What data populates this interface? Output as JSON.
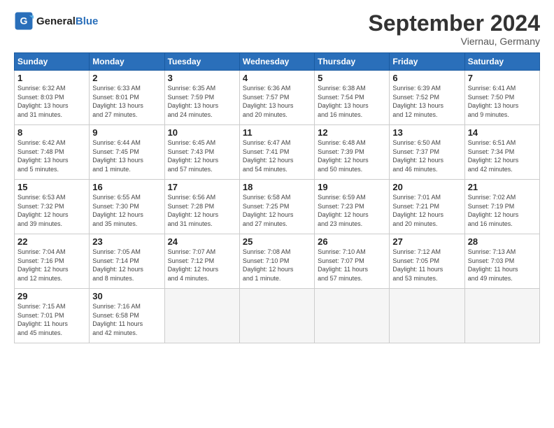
{
  "header": {
    "logo_general": "General",
    "logo_blue": "Blue",
    "month_title": "September 2024",
    "subtitle": "Viernau, Germany"
  },
  "weekdays": [
    "Sunday",
    "Monday",
    "Tuesday",
    "Wednesday",
    "Thursday",
    "Friday",
    "Saturday"
  ],
  "weeks": [
    [
      {
        "day": "1",
        "info": "Sunrise: 6:32 AM\nSunset: 8:03 PM\nDaylight: 13 hours\nand 31 minutes."
      },
      {
        "day": "2",
        "info": "Sunrise: 6:33 AM\nSunset: 8:01 PM\nDaylight: 13 hours\nand 27 minutes."
      },
      {
        "day": "3",
        "info": "Sunrise: 6:35 AM\nSunset: 7:59 PM\nDaylight: 13 hours\nand 24 minutes."
      },
      {
        "day": "4",
        "info": "Sunrise: 6:36 AM\nSunset: 7:57 PM\nDaylight: 13 hours\nand 20 minutes."
      },
      {
        "day": "5",
        "info": "Sunrise: 6:38 AM\nSunset: 7:54 PM\nDaylight: 13 hours\nand 16 minutes."
      },
      {
        "day": "6",
        "info": "Sunrise: 6:39 AM\nSunset: 7:52 PM\nDaylight: 13 hours\nand 12 minutes."
      },
      {
        "day": "7",
        "info": "Sunrise: 6:41 AM\nSunset: 7:50 PM\nDaylight: 13 hours\nand 9 minutes."
      }
    ],
    [
      {
        "day": "8",
        "info": "Sunrise: 6:42 AM\nSunset: 7:48 PM\nDaylight: 13 hours\nand 5 minutes."
      },
      {
        "day": "9",
        "info": "Sunrise: 6:44 AM\nSunset: 7:45 PM\nDaylight: 13 hours\nand 1 minute."
      },
      {
        "day": "10",
        "info": "Sunrise: 6:45 AM\nSunset: 7:43 PM\nDaylight: 12 hours\nand 57 minutes."
      },
      {
        "day": "11",
        "info": "Sunrise: 6:47 AM\nSunset: 7:41 PM\nDaylight: 12 hours\nand 54 minutes."
      },
      {
        "day": "12",
        "info": "Sunrise: 6:48 AM\nSunset: 7:39 PM\nDaylight: 12 hours\nand 50 minutes."
      },
      {
        "day": "13",
        "info": "Sunrise: 6:50 AM\nSunset: 7:37 PM\nDaylight: 12 hours\nand 46 minutes."
      },
      {
        "day": "14",
        "info": "Sunrise: 6:51 AM\nSunset: 7:34 PM\nDaylight: 12 hours\nand 42 minutes."
      }
    ],
    [
      {
        "day": "15",
        "info": "Sunrise: 6:53 AM\nSunset: 7:32 PM\nDaylight: 12 hours\nand 39 minutes."
      },
      {
        "day": "16",
        "info": "Sunrise: 6:55 AM\nSunset: 7:30 PM\nDaylight: 12 hours\nand 35 minutes."
      },
      {
        "day": "17",
        "info": "Sunrise: 6:56 AM\nSunset: 7:28 PM\nDaylight: 12 hours\nand 31 minutes."
      },
      {
        "day": "18",
        "info": "Sunrise: 6:58 AM\nSunset: 7:25 PM\nDaylight: 12 hours\nand 27 minutes."
      },
      {
        "day": "19",
        "info": "Sunrise: 6:59 AM\nSunset: 7:23 PM\nDaylight: 12 hours\nand 23 minutes."
      },
      {
        "day": "20",
        "info": "Sunrise: 7:01 AM\nSunset: 7:21 PM\nDaylight: 12 hours\nand 20 minutes."
      },
      {
        "day": "21",
        "info": "Sunrise: 7:02 AM\nSunset: 7:19 PM\nDaylight: 12 hours\nand 16 minutes."
      }
    ],
    [
      {
        "day": "22",
        "info": "Sunrise: 7:04 AM\nSunset: 7:16 PM\nDaylight: 12 hours\nand 12 minutes."
      },
      {
        "day": "23",
        "info": "Sunrise: 7:05 AM\nSunset: 7:14 PM\nDaylight: 12 hours\nand 8 minutes."
      },
      {
        "day": "24",
        "info": "Sunrise: 7:07 AM\nSunset: 7:12 PM\nDaylight: 12 hours\nand 4 minutes."
      },
      {
        "day": "25",
        "info": "Sunrise: 7:08 AM\nSunset: 7:10 PM\nDaylight: 12 hours\nand 1 minute."
      },
      {
        "day": "26",
        "info": "Sunrise: 7:10 AM\nSunset: 7:07 PM\nDaylight: 11 hours\nand 57 minutes."
      },
      {
        "day": "27",
        "info": "Sunrise: 7:12 AM\nSunset: 7:05 PM\nDaylight: 11 hours\nand 53 minutes."
      },
      {
        "day": "28",
        "info": "Sunrise: 7:13 AM\nSunset: 7:03 PM\nDaylight: 11 hours\nand 49 minutes."
      }
    ],
    [
      {
        "day": "29",
        "info": "Sunrise: 7:15 AM\nSunset: 7:01 PM\nDaylight: 11 hours\nand 45 minutes."
      },
      {
        "day": "30",
        "info": "Sunrise: 7:16 AM\nSunset: 6:58 PM\nDaylight: 11 hours\nand 42 minutes."
      },
      {
        "day": "",
        "info": ""
      },
      {
        "day": "",
        "info": ""
      },
      {
        "day": "",
        "info": ""
      },
      {
        "day": "",
        "info": ""
      },
      {
        "day": "",
        "info": ""
      }
    ]
  ]
}
